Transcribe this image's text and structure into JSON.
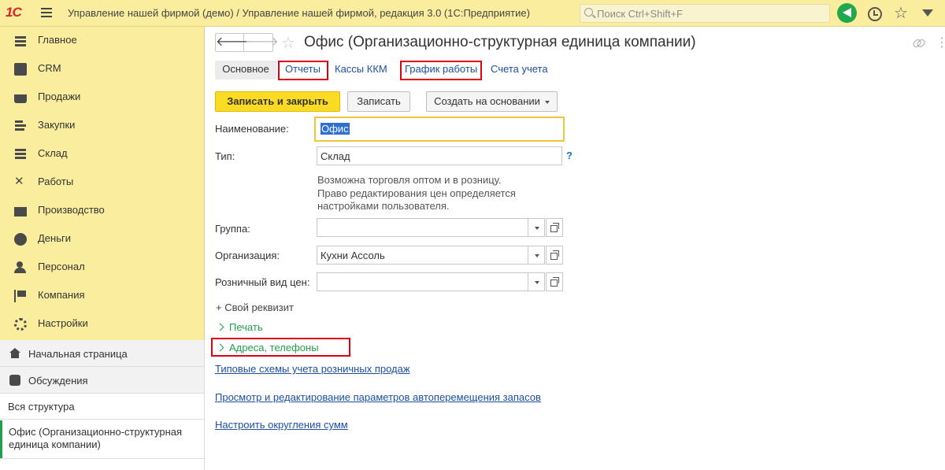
{
  "app": {
    "logo": "1С",
    "title": "Управление нашей фирмой (демо) / Управление нашей фирмой, редакция 3.0  (1С:Предприятие)",
    "search_placeholder": "Поиск Ctrl+Shift+F"
  },
  "sidebar": {
    "items": [
      {
        "label": "Главное",
        "icon": "menu-lines-icon"
      },
      {
        "label": "CRM",
        "icon": "contacts-card-icon"
      },
      {
        "label": "Продажи",
        "icon": "basket-icon"
      },
      {
        "label": "Закупки",
        "icon": "purchases-icon"
      },
      {
        "label": "Склад",
        "icon": "warehouse-icon"
      },
      {
        "label": "Работы",
        "icon": "tools-icon"
      },
      {
        "label": "Производство",
        "icon": "factory-icon"
      },
      {
        "label": "Деньги",
        "icon": "money-coin-icon"
      },
      {
        "label": "Персонал",
        "icon": "people-icon"
      },
      {
        "label": "Компания",
        "icon": "flag-icon"
      },
      {
        "label": "Настройки",
        "icon": "gear-icon"
      }
    ],
    "home_label": "Начальная страница",
    "discussions_label": "Обсуждения",
    "all_structure_label": "Вся структура",
    "active_window_label": "Офис (Организационно-структурная единица компании)"
  },
  "form": {
    "title": "Офис (Организационно-структурная единица компании)",
    "tabs": {
      "main": "Основное",
      "reports": "Отчеты",
      "cash_registers": "Кассы ККМ",
      "schedule": "График работы",
      "accounts": "Счета учета"
    },
    "buttons": {
      "save_close": "Записать и закрыть",
      "save": "Записать",
      "create_based": "Создать на основании"
    },
    "fields": {
      "name_label": "Наименование:",
      "name_value": "Офис",
      "type_label": "Тип:",
      "type_value": "Склад",
      "type_help": "?",
      "hint_line1": "Возможна торговля оптом и в розницу.",
      "hint_line2": "Право редактирования цен определяется",
      "hint_line3": "настройками пользователя.",
      "group_label": "Группа:",
      "group_value": "",
      "org_label": "Организация:",
      "org_value": "Кухни Ассоль",
      "price_label": "Розничный вид цен:",
      "price_value": ""
    },
    "own_attribute": "+ Свой реквизит",
    "groups": {
      "print": "Печать",
      "addresses": "Адреса, телефоны"
    },
    "links": {
      "retail_schemes": "Типовые схемы учета розничных продаж",
      "auto_transfer": "Просмотр и редактирование параметров автоперемещения запасов",
      "rounding": "Настроить округления сумм"
    }
  },
  "colors": {
    "topbar": "#fbed9e",
    "accent_green": "#21a04b",
    "primary_button": "#fbdb24",
    "link": "#1d4fa3",
    "highlight_box": "#e00012"
  }
}
